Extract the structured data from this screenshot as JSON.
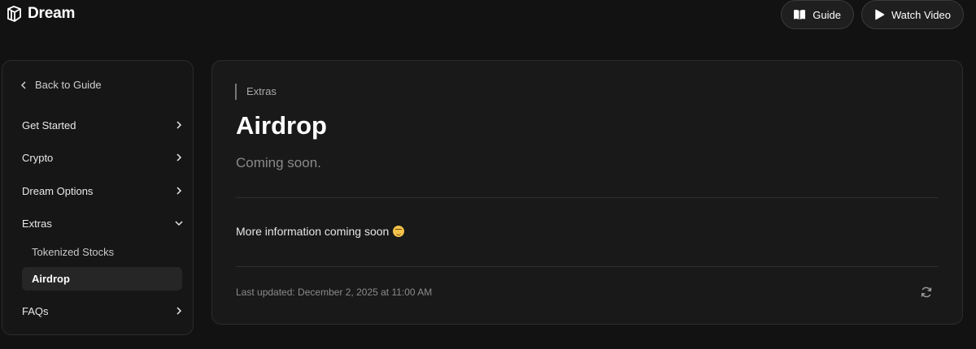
{
  "brand": {
    "name": "Dream",
    "logo_icon": "cube-logo-icon"
  },
  "header": {
    "guide_button": {
      "label": "Guide",
      "icon": "book-icon"
    },
    "video_button": {
      "label": "Watch Video",
      "icon": "play-icon"
    }
  },
  "sidebar": {
    "back_label": "Back to Guide",
    "items": [
      {
        "label": "Get Started",
        "expanded": false
      },
      {
        "label": "Crypto",
        "expanded": false
      },
      {
        "label": "Dream Options",
        "expanded": false
      },
      {
        "label": "Extras",
        "expanded": true
      },
      {
        "label": "FAQs",
        "expanded": false
      }
    ],
    "sub_items": [
      {
        "label": "Tokenized Stocks",
        "active": false
      },
      {
        "label": "Airdrop",
        "active": true
      }
    ]
  },
  "main": {
    "breadcrumb": "Extras",
    "title": "Airdrop",
    "subtitle": "Coming soon.",
    "body": "More information coming soon",
    "body_emoji": "smirk-emoji",
    "last_updated": "Last updated: December 2, 2025 at 11:00 AM",
    "refresh_icon": "refresh-icon"
  },
  "colors": {
    "background": "#121212",
    "panel": "#191919",
    "border": "#2c2c2c",
    "muted_text": "#8a8a8a"
  }
}
